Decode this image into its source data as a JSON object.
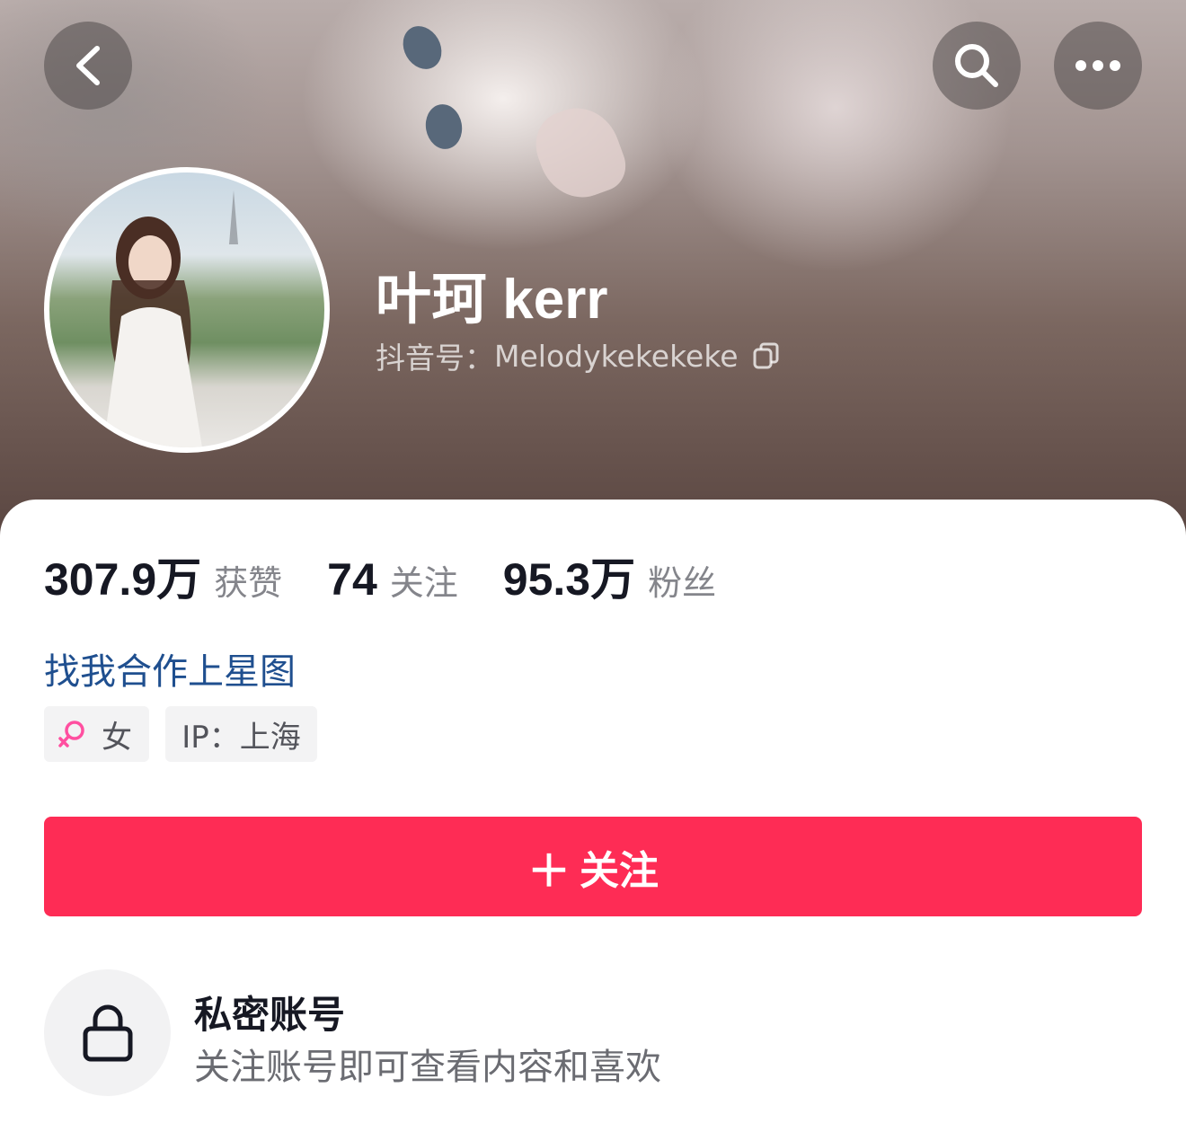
{
  "profile": {
    "name": "叶珂 kerr",
    "douyin_id_label": "抖音号：",
    "douyin_id": "Melodykekekeke"
  },
  "stats": {
    "likes": {
      "value": "307.9万",
      "label": "获赞"
    },
    "following": {
      "value": "74",
      "label": "关注"
    },
    "followers": {
      "value": "95.3万",
      "label": "粉丝"
    }
  },
  "cooperate_link": "找我合作上星图",
  "tags": {
    "gender": "女",
    "ip": "IP：上海"
  },
  "follow_button": {
    "icon": "＋",
    "label": "关注"
  },
  "private_account": {
    "title": "私密账号",
    "description": "关注账号即可查看内容和喜欢"
  },
  "icons": {
    "back": "chevron-left-icon",
    "search": "search-icon",
    "more": "more-icon",
    "copy": "copy-icon",
    "gender": "female-icon",
    "lock": "lock-icon"
  },
  "colors": {
    "accent": "#fe2c55",
    "link": "#1f4f8f",
    "female": "#ff4fa0"
  }
}
